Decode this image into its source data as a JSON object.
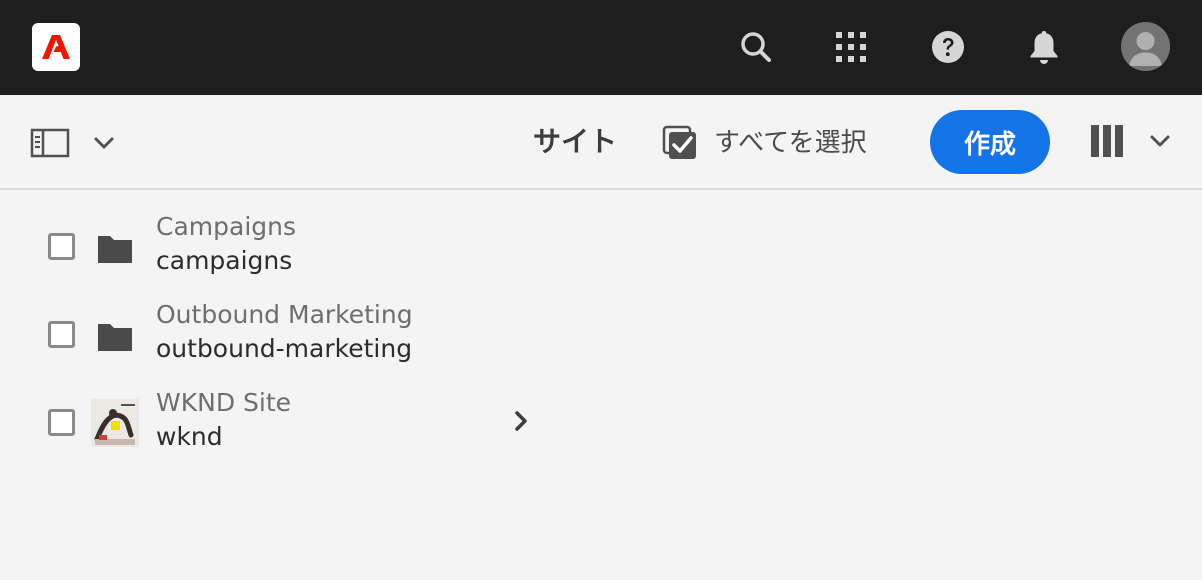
{
  "header": {
    "logo_icon": "adobe-logo",
    "brand_color": "#fa0f00",
    "icons": [
      "search-icon",
      "apps-grid-icon",
      "help-icon",
      "bell-icon"
    ],
    "avatar_icon": "user-avatar"
  },
  "actionbar": {
    "rail_toggle_icon": "side-rail-icon",
    "title": "サイト",
    "select_all_label": "すべてを選択",
    "create_label": "作成",
    "view_icon": "column-view-icon",
    "accent_color": "#1473e6"
  },
  "items": [
    {
      "title": "Campaigns",
      "name": "campaigns",
      "icon": "folder-icon",
      "has_children": false
    },
    {
      "title": "Outbound Marketing",
      "name": "outbound-marketing",
      "icon": "folder-icon",
      "has_children": false
    },
    {
      "title": "WKND Site",
      "name": "wknd",
      "icon": "site-thumbnail",
      "has_children": true
    }
  ]
}
